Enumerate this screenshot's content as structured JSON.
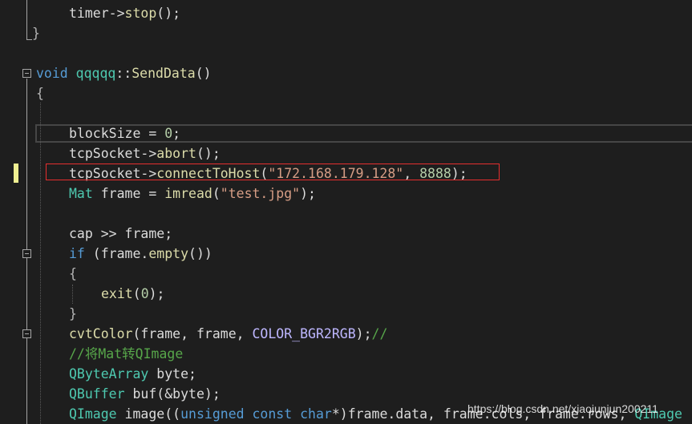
{
  "editor": {
    "lines": [
      [
        {
          "t": "timer->",
          "c": "t-id"
        },
        {
          "t": "stop",
          "c": "t-fn"
        },
        {
          "t": "();",
          "c": "t-id"
        }
      ],
      [
        {
          "t": "}",
          "c": "t-punc"
        }
      ],
      [],
      [
        {
          "t": "void ",
          "c": "t-kw"
        },
        {
          "t": "qqqqq",
          "c": "t-ty"
        },
        {
          "t": "::",
          "c": "t-id"
        },
        {
          "t": "SendData",
          "c": "t-fn"
        },
        {
          "t": "()",
          "c": "t-id"
        }
      ],
      [
        {
          "t": "{",
          "c": "t-punc"
        }
      ],
      [],
      [
        {
          "t": "blockSize",
          "c": "t-id"
        },
        {
          "t": " = ",
          "c": "t-id"
        },
        {
          "t": "0",
          "c": "t-num"
        },
        {
          "t": ";",
          "c": "t-id"
        }
      ],
      [
        {
          "t": "tcpSocket->",
          "c": "t-id"
        },
        {
          "t": "abort",
          "c": "t-fn"
        },
        {
          "t": "();",
          "c": "t-id"
        }
      ],
      [
        {
          "t": "tcpSocket->",
          "c": "t-id"
        },
        {
          "t": "connectToHost",
          "c": "t-fn"
        },
        {
          "t": "(",
          "c": "t-id"
        },
        {
          "t": "\"172.168.179.128\"",
          "c": "t-str"
        },
        {
          "t": ", ",
          "c": "t-id"
        },
        {
          "t": "8888",
          "c": "t-num"
        },
        {
          "t": ");",
          "c": "t-id"
        }
      ],
      [
        {
          "t": "Mat",
          "c": "t-ty"
        },
        {
          "t": " frame = ",
          "c": "t-id"
        },
        {
          "t": "imread",
          "c": "t-fn"
        },
        {
          "t": "(",
          "c": "t-id"
        },
        {
          "t": "\"test.jpg\"",
          "c": "t-str"
        },
        {
          "t": ");",
          "c": "t-id"
        }
      ],
      [],
      [
        {
          "t": "cap >> frame;",
          "c": "t-id"
        }
      ],
      [
        {
          "t": "if",
          "c": "t-kw"
        },
        {
          "t": " (frame.",
          "c": "t-id"
        },
        {
          "t": "empty",
          "c": "t-fn"
        },
        {
          "t": "())",
          "c": "t-id"
        }
      ],
      [
        {
          "t": "{",
          "c": "t-punc"
        }
      ],
      [
        {
          "t": "exit",
          "c": "t-fn"
        },
        {
          "t": "(",
          "c": "t-id"
        },
        {
          "t": "0",
          "c": "t-num"
        },
        {
          "t": ");",
          "c": "t-id"
        }
      ],
      [
        {
          "t": "}",
          "c": "t-punc"
        }
      ],
      [
        {
          "t": "cvtColor",
          "c": "t-fn"
        },
        {
          "t": "(frame, frame, ",
          "c": "t-id"
        },
        {
          "t": "COLOR_BGR2RGB",
          "c": "t-mac"
        },
        {
          "t": ");",
          "c": "t-id"
        },
        {
          "t": "//",
          "c": "t-cm"
        }
      ],
      [
        {
          "t": "//将Mat转QImage",
          "c": "t-cm"
        }
      ],
      [
        {
          "t": "QByteArray",
          "c": "t-ty"
        },
        {
          "t": " byte;",
          "c": "t-id"
        }
      ],
      [
        {
          "t": "QBuffer",
          "c": "t-ty"
        },
        {
          "t": " buf(&byte);",
          "c": "t-id"
        }
      ],
      [
        {
          "t": "QImage",
          "c": "t-ty"
        },
        {
          "t": " image((",
          "c": "t-id"
        },
        {
          "t": "unsigned const char",
          "c": "t-kw"
        },
        {
          "t": "*)frame.data, frame.cols, frame.rows, ",
          "c": "t-id"
        },
        {
          "t": "QImage",
          "c": "t-ty"
        }
      ]
    ]
  },
  "watermark": {
    "text": "https://blog.csdn.net/xiaojunjun200211"
  },
  "colors": {
    "background": "#1e1e1e",
    "keyword": "#569cd6",
    "type": "#4ec9b0",
    "function": "#dcdcaa",
    "string": "#d69d85",
    "number": "#b5cea8",
    "comment": "#57a64a",
    "highlight_box": "#e62e2e",
    "change_marker": "#efef91"
  }
}
